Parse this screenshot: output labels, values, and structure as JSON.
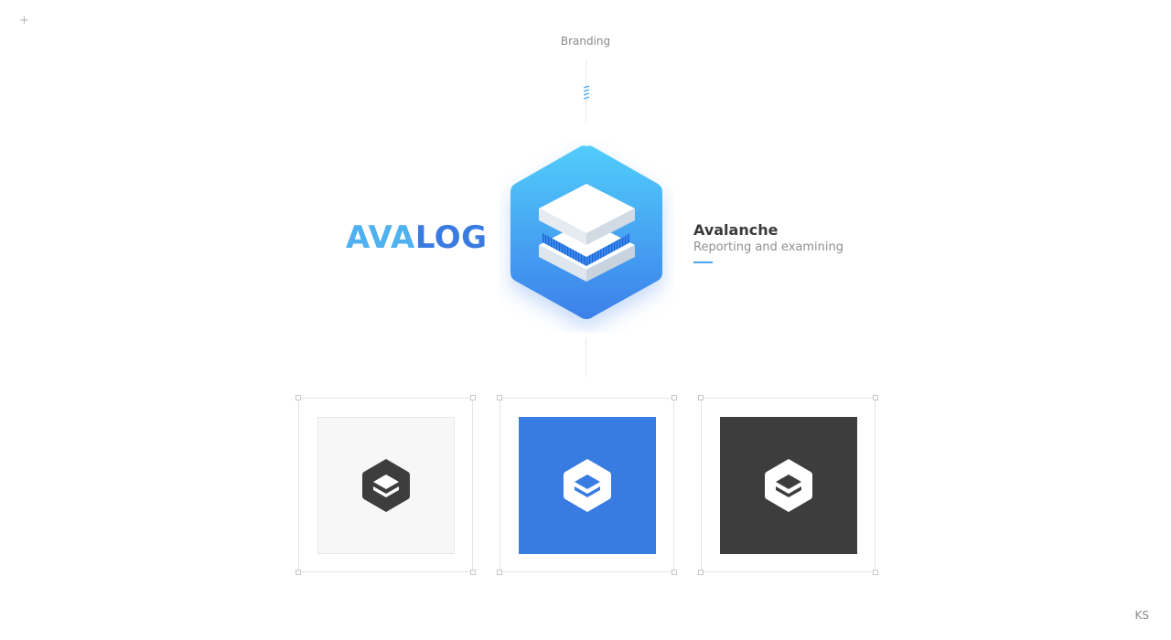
{
  "header": {
    "plus_glyph": "+",
    "section_label": "Branding"
  },
  "wordmark": {
    "part_a": "AVA",
    "part_b": "LOG",
    "colors": {
      "part_a": "#4fb1f0",
      "part_b": "#3a7be2"
    }
  },
  "brand": {
    "name": "Avalanche",
    "tagline": "Reporting and examining",
    "accent": "#4aa7f0",
    "logo_icon": "layered-hexagon-icon",
    "gradient": [
      "#52cdfb",
      "#3c80ea"
    ]
  },
  "variants": [
    {
      "name": "light",
      "background": "#f7f7f7",
      "hex_color": "#3d3d3d",
      "layer_color": "#ffffff"
    },
    {
      "name": "blue",
      "background": "#387ce2",
      "hex_color": "#ffffff",
      "layer_color": "#387ce2"
    },
    {
      "name": "dark",
      "background": "#3d3d3d",
      "hex_color": "#ffffff",
      "layer_color": "#3d3d3d"
    }
  ],
  "footer": {
    "initials": "KS"
  }
}
